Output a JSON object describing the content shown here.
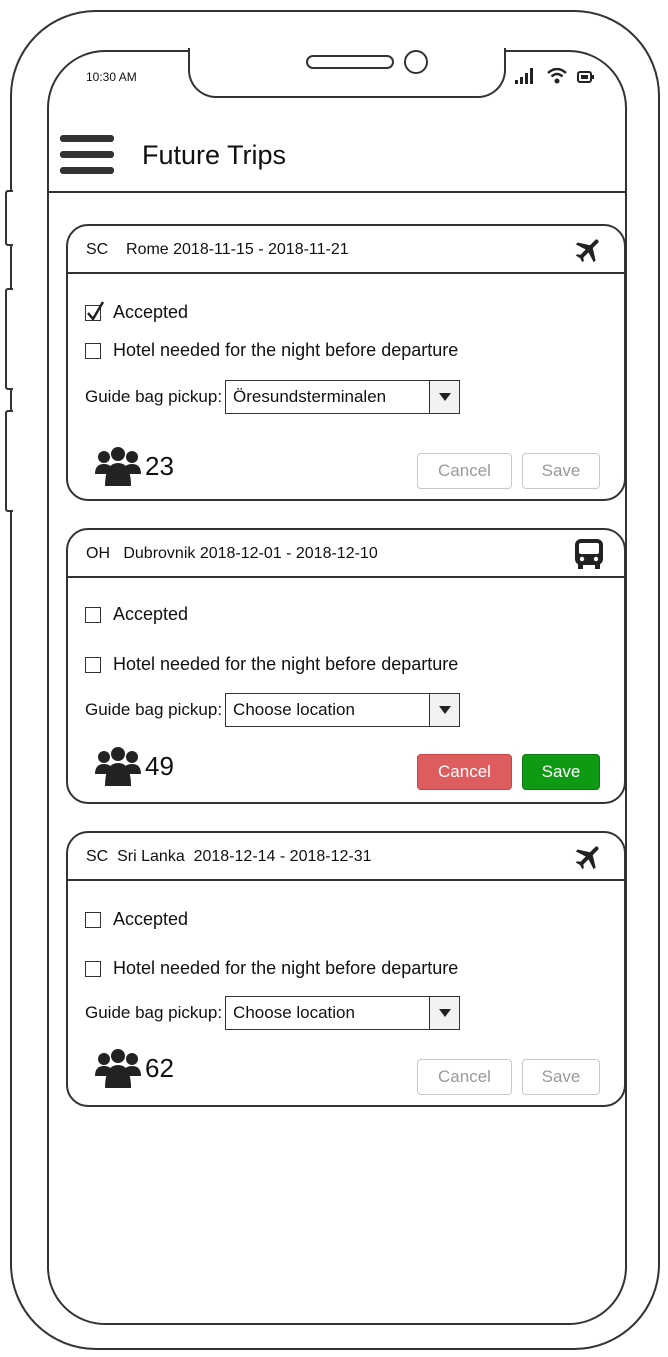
{
  "status": {
    "time": "10:30 AM"
  },
  "header": {
    "title": "Future Trips"
  },
  "trips": [
    {
      "title": "SC    Rome 2018-11-15 - 2018-11-21",
      "transport": "airplane-icon",
      "accepted": true,
      "accepted_label": "Accepted",
      "hotel_label": "Hotel needed for the night before departure",
      "pickup_label": "Guide bag pickup:",
      "pickup_value": "Öresundsterminalen",
      "travelers": "23",
      "cancel_label": "Cancel",
      "save_label": "Save",
      "buttons_enabled": false
    },
    {
      "title": "OH   Dubrovnik 2018-12-01 - 2018-12-10",
      "transport": "bus-icon",
      "accepted": false,
      "accepted_label": "Accepted",
      "hotel_label": "Hotel needed for the night before departure",
      "pickup_label": "Guide bag pickup:",
      "pickup_value": "Choose location",
      "travelers": "49",
      "cancel_label": "Cancel",
      "save_label": "Save",
      "buttons_enabled": true
    },
    {
      "title": "SC  Sri Lanka  2018-12-14 - 2018-12-31",
      "transport": "airplane-icon",
      "accepted": false,
      "accepted_label": "Accepted",
      "hotel_label": "Hotel needed for the night before departure",
      "pickup_label": "Guide bag pickup:",
      "pickup_value": "Choose location",
      "travelers": "62",
      "cancel_label": "Cancel",
      "save_label": "Save",
      "buttons_enabled": false
    }
  ],
  "colors": {
    "cancel_active": "#dd5d5f",
    "save_active": "#0f9a14",
    "disabled_text": "#9a9a9a"
  }
}
